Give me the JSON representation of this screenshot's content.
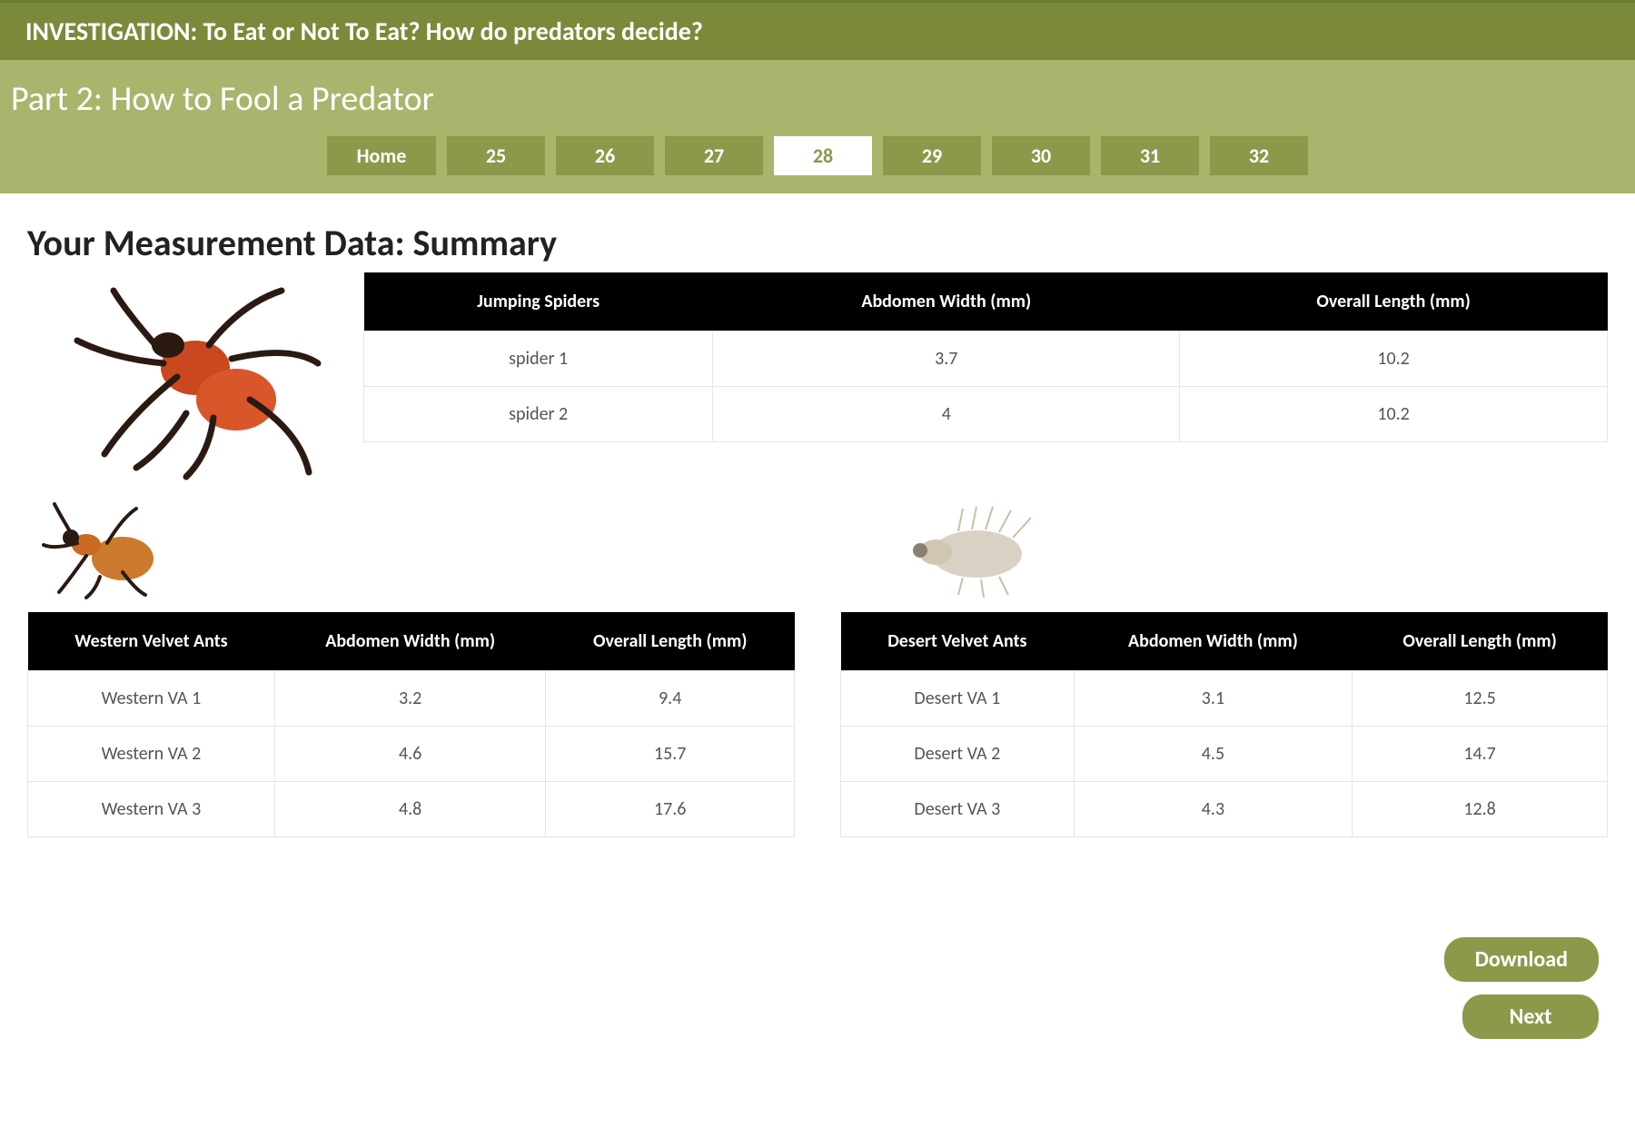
{
  "header": {
    "investigation": "INVESTIGATION: To Eat or Not To Eat? How do predators decide?",
    "part": "Part 2: How to Fool a Predator"
  },
  "nav": {
    "home": "Home",
    "pages": [
      "25",
      "26",
      "27",
      "28",
      "29",
      "30",
      "31",
      "32"
    ],
    "active": "28"
  },
  "section_title": "Your Measurement Data: Summary",
  "tables": {
    "spiders": {
      "headers": [
        "Jumping Spiders",
        "Abdomen Width (mm)",
        "Overall Length (mm)"
      ],
      "rows": [
        {
          "name": "spider 1",
          "abdomen": "3.7",
          "length": "10.2"
        },
        {
          "name": "spider 2",
          "abdomen": "4",
          "length": "10.2"
        }
      ]
    },
    "western": {
      "headers": [
        "Western Velvet Ants",
        "Abdomen Width (mm)",
        "Overall Length (mm)"
      ],
      "rows": [
        {
          "name": "Western VA 1",
          "abdomen": "3.2",
          "length": "9.4"
        },
        {
          "name": "Western VA 2",
          "abdomen": "4.6",
          "length": "15.7"
        },
        {
          "name": "Western VA 3",
          "abdomen": "4.8",
          "length": "17.6"
        }
      ]
    },
    "desert": {
      "headers": [
        "Desert Velvet Ants",
        "Abdomen Width (mm)",
        "Overall Length (mm)"
      ],
      "rows": [
        {
          "name": "Desert VA 1",
          "abdomen": "3.1",
          "length": "12.5"
        },
        {
          "name": "Desert VA 2",
          "abdomen": "4.5",
          "length": "14.7"
        },
        {
          "name": "Desert VA 3",
          "abdomen": "4.3",
          "length": "12.8"
        }
      ]
    }
  },
  "buttons": {
    "download": "Download",
    "next": "Next"
  },
  "icons": {
    "spider": "jumping-spider-image",
    "western_ant": "western-velvet-ant-image",
    "desert_ant": "desert-velvet-ant-image"
  }
}
